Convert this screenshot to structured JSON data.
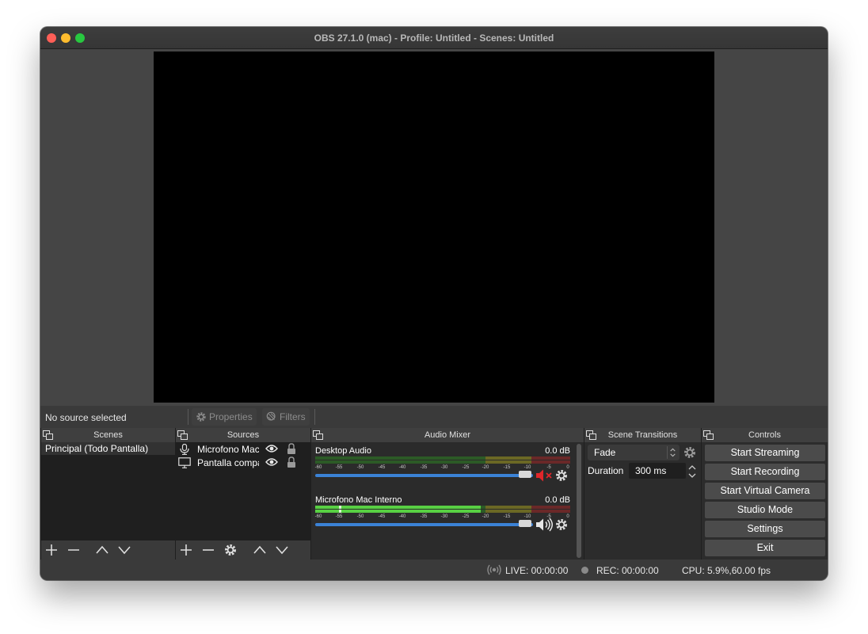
{
  "window": {
    "title": "OBS 27.1.0 (mac) - Profile: Untitled - Scenes: Untitled"
  },
  "source_toolbar": {
    "status": "No source selected",
    "properties_label": "Properties",
    "filters_label": "Filters"
  },
  "scenes": {
    "header": "Scenes",
    "items": [
      {
        "label": "Principal (Todo Pantalla)",
        "selected": true
      }
    ]
  },
  "sources": {
    "header": "Sources",
    "items": [
      {
        "label": "Microfono Mac Interno",
        "icon": "microphone-icon"
      },
      {
        "label": "Pantalla compartida",
        "icon": "monitor-icon"
      }
    ]
  },
  "mixer": {
    "header": "Audio Mixer",
    "tick_labels": [
      "-60",
      "-55",
      "-50",
      "-45",
      "-40",
      "-35",
      "-30",
      "-25",
      "-20",
      "-15",
      "-10",
      "-5",
      "0"
    ],
    "channels": [
      {
        "name": "Desktop Audio",
        "db": "0.0 dB",
        "muted": true,
        "level": 0.0
      },
      {
        "name": "Microfono Mac Interno",
        "db": "0.0 dB",
        "muted": false,
        "level": 0.65
      }
    ]
  },
  "transitions": {
    "header": "Scene Transitions",
    "selected": "Fade",
    "duration_label": "Duration",
    "duration_value": "300 ms"
  },
  "controls": {
    "header": "Controls",
    "buttons": [
      "Start Streaming",
      "Start Recording",
      "Start Virtual Camera",
      "Studio Mode",
      "Settings",
      "Exit"
    ]
  },
  "status": {
    "live": "LIVE: 00:00:00",
    "rec": "REC: 00:00:00",
    "cpu": "CPU: 5.9%,60.00 fps"
  },
  "colors": {
    "meter_green": "#3c8f2f",
    "meter_yellow": "#8e8a2a",
    "meter_red": "#8a2f2f",
    "fader_blue": "#3b82d6",
    "mute_red": "#e0262a"
  }
}
